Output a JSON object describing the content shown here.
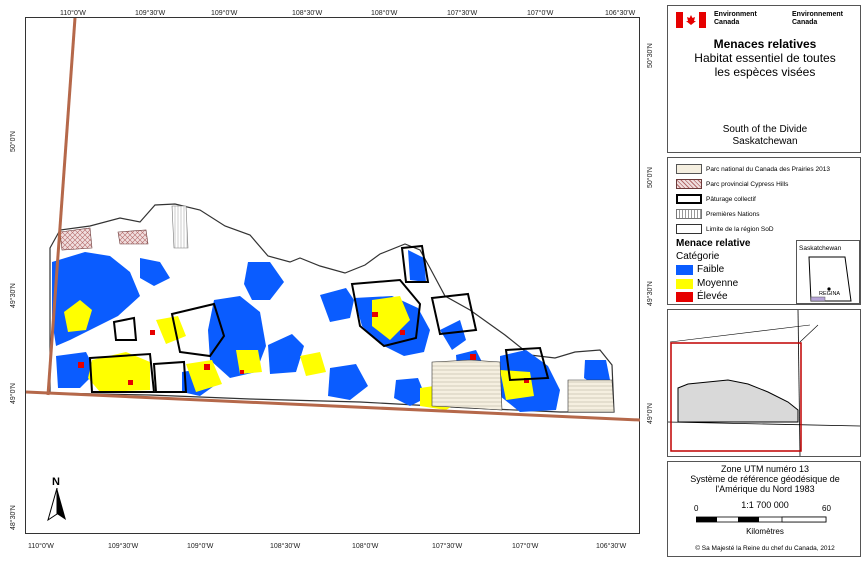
{
  "map": {
    "top_ticks": [
      "110°0'W",
      "109°30'W",
      "109°0'W",
      "108°30'W",
      "108°0'W",
      "107°30'W",
      "107°0'W",
      "106°30'W"
    ],
    "bottom_ticks": [
      "110°0'W",
      "109°30'W",
      "109°0'W",
      "108°30'W",
      "108°0'W",
      "107°30'W",
      "107°0'W",
      "106°30'W"
    ],
    "left_ticks": [
      "50°0'N",
      "49°30'N",
      "49°0'N",
      "48°30'N"
    ],
    "right_ticks": [
      "50°30'N",
      "50°0'N",
      "49°30'N",
      "49°0'N"
    ],
    "north_label": "N"
  },
  "title_panel": {
    "agency_en": "Environment\nCanada",
    "agency_fr": "Environnement\nCanada",
    "title": "Menaces relatives",
    "subtitle_line1": "Habitat essentiel de toutes",
    "subtitle_line2": "les espèces visées",
    "region_line1": "South of the Divide",
    "region_line2": "Saskatchewan"
  },
  "legend": {
    "items": [
      {
        "label": "Parc national du Canada des Prairies 2013",
        "kind": "national-park"
      },
      {
        "label": "Parc provincial Cypress Hills",
        "kind": "provincial-park"
      },
      {
        "label": "Pâturage collectif",
        "kind": "community-pasture"
      },
      {
        "label": "Premières Nations",
        "kind": "first-nations"
      },
      {
        "label": "Limite de la région SoD",
        "kind": "sod-boundary"
      }
    ],
    "heading": "Menace relative",
    "category_heading": "Catégorie",
    "categories": [
      {
        "label": "Faible",
        "color": "#0a5cff"
      },
      {
        "label": "Moyenne",
        "color": "#ffff00"
      },
      {
        "label": "Élevée",
        "color": "#e60000"
      }
    ],
    "inset_province": "Saskatchewan",
    "inset_city": "REGINA"
  },
  "info_panel": {
    "projection_line1": "Zone UTM numéro 13",
    "projection_line2": "Système de référence géodésique de",
    "projection_line3": "l'Amérique du Nord 1983",
    "scale_min": "0",
    "scale_max": "60",
    "scale_ratio": "1:1 700 000",
    "scale_unit": "Kilomètres",
    "copyright": "© Sa Majesté la Reine du chef du Canada, 2012"
  },
  "colors": {
    "low": "#0a5cff",
    "medium": "#ffff00",
    "high": "#e60000",
    "road": "#b5684a"
  }
}
